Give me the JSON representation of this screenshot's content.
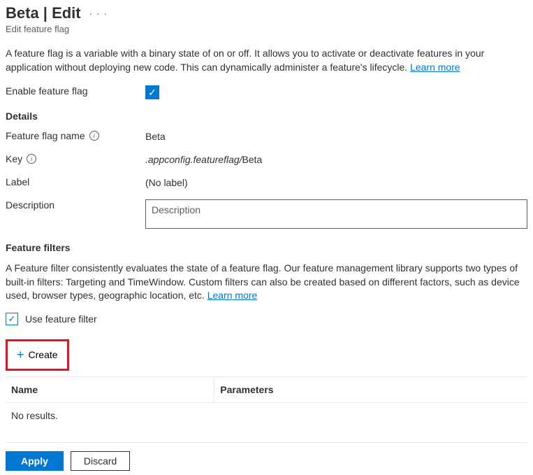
{
  "header": {
    "title": "Beta | Edit",
    "subtitle": "Edit feature flag"
  },
  "intro": {
    "text": "A feature flag is a variable with a binary state of on or off. It allows you to activate or deactivate features in your application without deploying new code. This can dynamically administer a feature's lifecycle. ",
    "learn_more": "Learn more"
  },
  "enable": {
    "label": "Enable feature flag",
    "checked": true
  },
  "details": {
    "heading": "Details",
    "name_label": "Feature flag name",
    "name_value": "Beta",
    "key_label": "Key",
    "key_prefix": ".appconfig.featureflag/",
    "key_value": "Beta",
    "label_label": "Label",
    "label_value": "(No label)",
    "description_label": "Description",
    "description_placeholder": "Description"
  },
  "filters": {
    "heading": "Feature filters",
    "text": "A Feature filter consistently evaluates the state of a feature flag. Our feature management library supports two types of built-in filters: Targeting and TimeWindow. Custom filters can also be created based on different factors, such as device used, browser types, geographic location, etc. ",
    "learn_more": "Learn more",
    "use_filter_label": "Use feature filter",
    "use_filter_checked": true,
    "create_label": "Create",
    "table": {
      "col_name": "Name",
      "col_params": "Parameters",
      "empty": "No results."
    }
  },
  "actions": {
    "apply": "Apply",
    "discard": "Discard"
  }
}
